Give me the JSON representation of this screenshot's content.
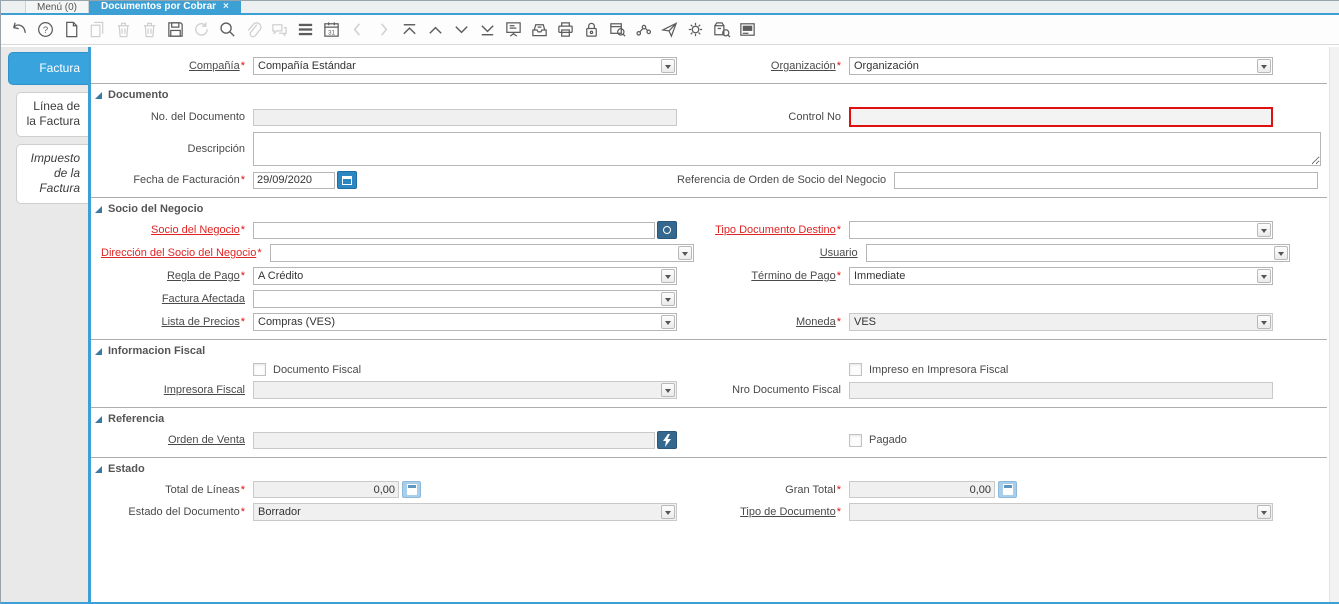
{
  "window": {
    "tabs": [
      {
        "label": "Menú (0)"
      },
      {
        "label": "Documentos por Cobrar",
        "close_glyph": "×"
      }
    ]
  },
  "toolbar": {
    "calendar_day": "31",
    "help_glyph": "?",
    "icons": [
      "undo",
      "help",
      "new-record",
      "copy-record",
      "delete-record",
      "delete-selection",
      "save",
      "refresh",
      "find",
      "attachment",
      "chat",
      "toggle-grid",
      "calendar-history",
      "previous-record",
      "next-record",
      "first-record",
      "previous",
      "next",
      "last-record",
      "report",
      "archive",
      "print",
      "lock",
      "zoom-across",
      "workflow",
      "send-mail",
      "process",
      "product-info",
      "help-window"
    ]
  },
  "sidebar": {
    "tabs": [
      {
        "label": "Factura",
        "active": true
      },
      {
        "label": "Línea de la Factura"
      },
      {
        "label": "Impuesto de la Factura",
        "italic": true
      }
    ]
  },
  "colors": {
    "accent_blue": "#3da0d4",
    "active_tab_blue": "#38a3dc",
    "dark_button_blue": "#35688e",
    "calendar_button_blue": "#2e86c1",
    "calc_button_blue": "#a9cee9",
    "error_red": "#e01010"
  },
  "form": {
    "compania": {
      "label": "Compañía",
      "req": "*",
      "value": "Compañía Estándar"
    },
    "organizacion": {
      "label": "Organización",
      "req": "*",
      "value": "Organización"
    },
    "sections": {
      "documento": "Documento",
      "socio": "Socio del Negocio",
      "fiscal": "Informacion Fiscal",
      "referencia": "Referencia",
      "estado": "Estado"
    },
    "no_documento": {
      "label": "No. del Documento",
      "value": ""
    },
    "control_no": {
      "label": "Control No",
      "value": ""
    },
    "descripcion": {
      "label": "Descripción",
      "value": ""
    },
    "fecha_facturacion": {
      "label": "Fecha de Facturación",
      "req": "*",
      "value": "29/09/2020"
    },
    "referencia_orden": {
      "label": "Referencia de Orden de Socio del Negocio",
      "value": ""
    },
    "socio_negocio": {
      "label": "Socio del Negocio",
      "req": "*",
      "value": ""
    },
    "tipo_doc_destino": {
      "label": "Tipo Documento Destino",
      "req": "*",
      "value": ""
    },
    "direccion_socio": {
      "label": "Dirección del Socio del Negocio",
      "req": "*",
      "value": ""
    },
    "usuario": {
      "label": "Usuario",
      "value": ""
    },
    "regla_pago": {
      "label": "Regla de Pago",
      "req": "*",
      "value": "A Crédito"
    },
    "termino_pago": {
      "label": "Término de Pago",
      "req": "*",
      "value": "Immediate"
    },
    "factura_afectada": {
      "label": "Factura Afectada",
      "value": ""
    },
    "lista_precios": {
      "label": "Lista de Precios",
      "req": "*",
      "value": "Compras (VES)"
    },
    "moneda": {
      "label": "Moneda",
      "req": "*",
      "value": "VES"
    },
    "documento_fiscal": {
      "label": "Documento Fiscal",
      "checked": false
    },
    "impreso_fiscal": {
      "label": "Impreso en Impresora Fiscal",
      "checked": false
    },
    "impresora_fiscal": {
      "label": "Impresora Fiscal",
      "value": ""
    },
    "nro_doc_fiscal": {
      "label": "Nro Documento Fiscal",
      "value": ""
    },
    "orden_venta": {
      "label": "Orden de Venta",
      "value": ""
    },
    "pagado": {
      "label": "Pagado",
      "checked": false
    },
    "total_lineas": {
      "label": "Total de Líneas",
      "req": "*",
      "value": "0,00"
    },
    "gran_total": {
      "label": "Gran Total",
      "req": "*",
      "value": "0,00"
    },
    "estado_documento": {
      "label": "Estado del Documento",
      "req": "*",
      "value": "Borrador"
    },
    "tipo_documento": {
      "label": "Tipo de Documento",
      "req": "*",
      "value": ""
    }
  }
}
